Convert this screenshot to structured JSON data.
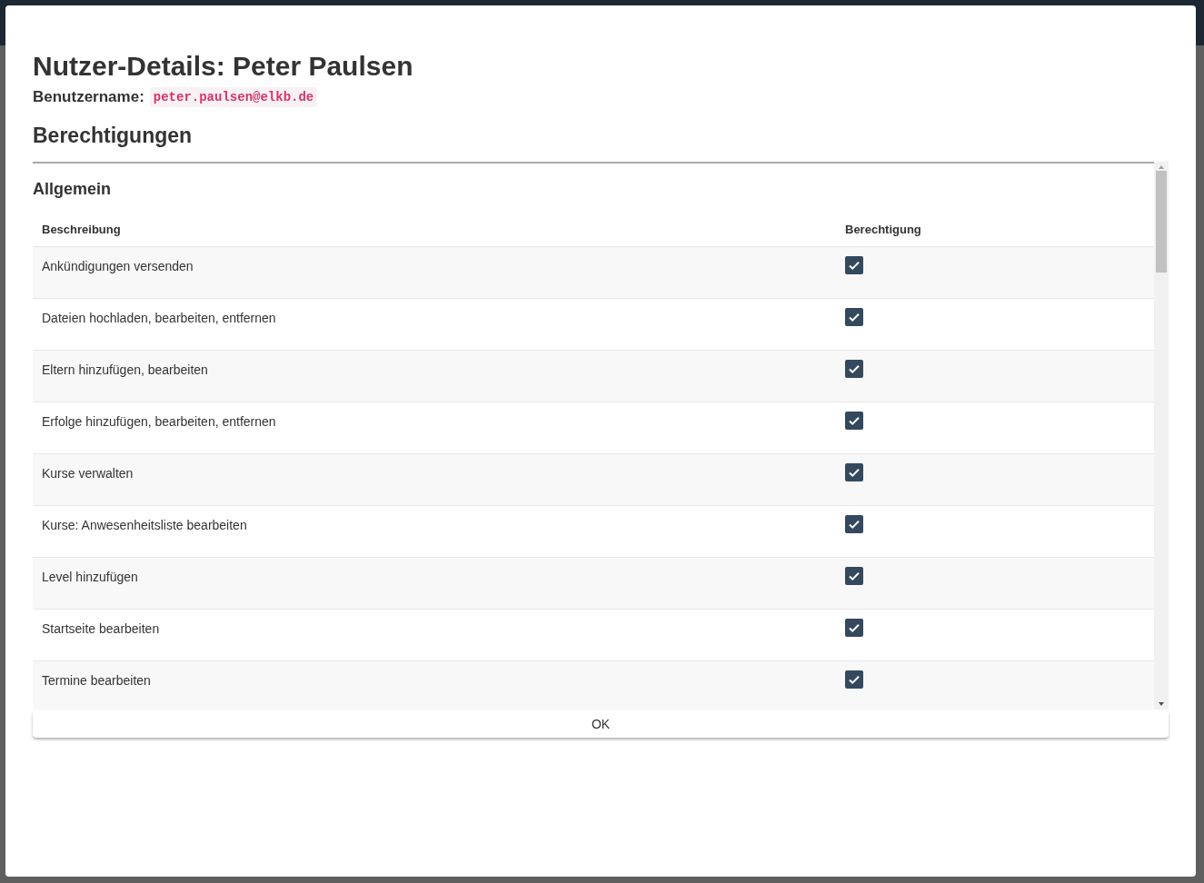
{
  "dialog": {
    "title": "Nutzer-Details: Peter Paulsen",
    "username_label": "Benutzername:",
    "username": "peter.paulsen@elkb.de",
    "section_title": "Berechtigungen",
    "groups": [
      {
        "title": "Allgemein",
        "columns": [
          "Beschreibung",
          "Berechtigung"
        ],
        "rows": [
          {
            "description": "Ankündigungen versenden",
            "checked": true
          },
          {
            "description": "Dateien hochladen, bearbeiten, entfernen",
            "checked": true
          },
          {
            "description": "Eltern hinzufügen, bearbeiten",
            "checked": true
          },
          {
            "description": "Erfolge hinzufügen, bearbeiten, entfernen",
            "checked": true
          },
          {
            "description": "Kurse verwalten",
            "checked": true
          },
          {
            "description": "Kurse: Anwesenheitsliste bearbeiten",
            "checked": true
          },
          {
            "description": "Level hinzufügen",
            "checked": true
          },
          {
            "description": "Startseite bearbeiten",
            "checked": true
          },
          {
            "description": "Termine bearbeiten",
            "checked": true
          }
        ]
      }
    ],
    "buttons": [
      "OK"
    ]
  }
}
